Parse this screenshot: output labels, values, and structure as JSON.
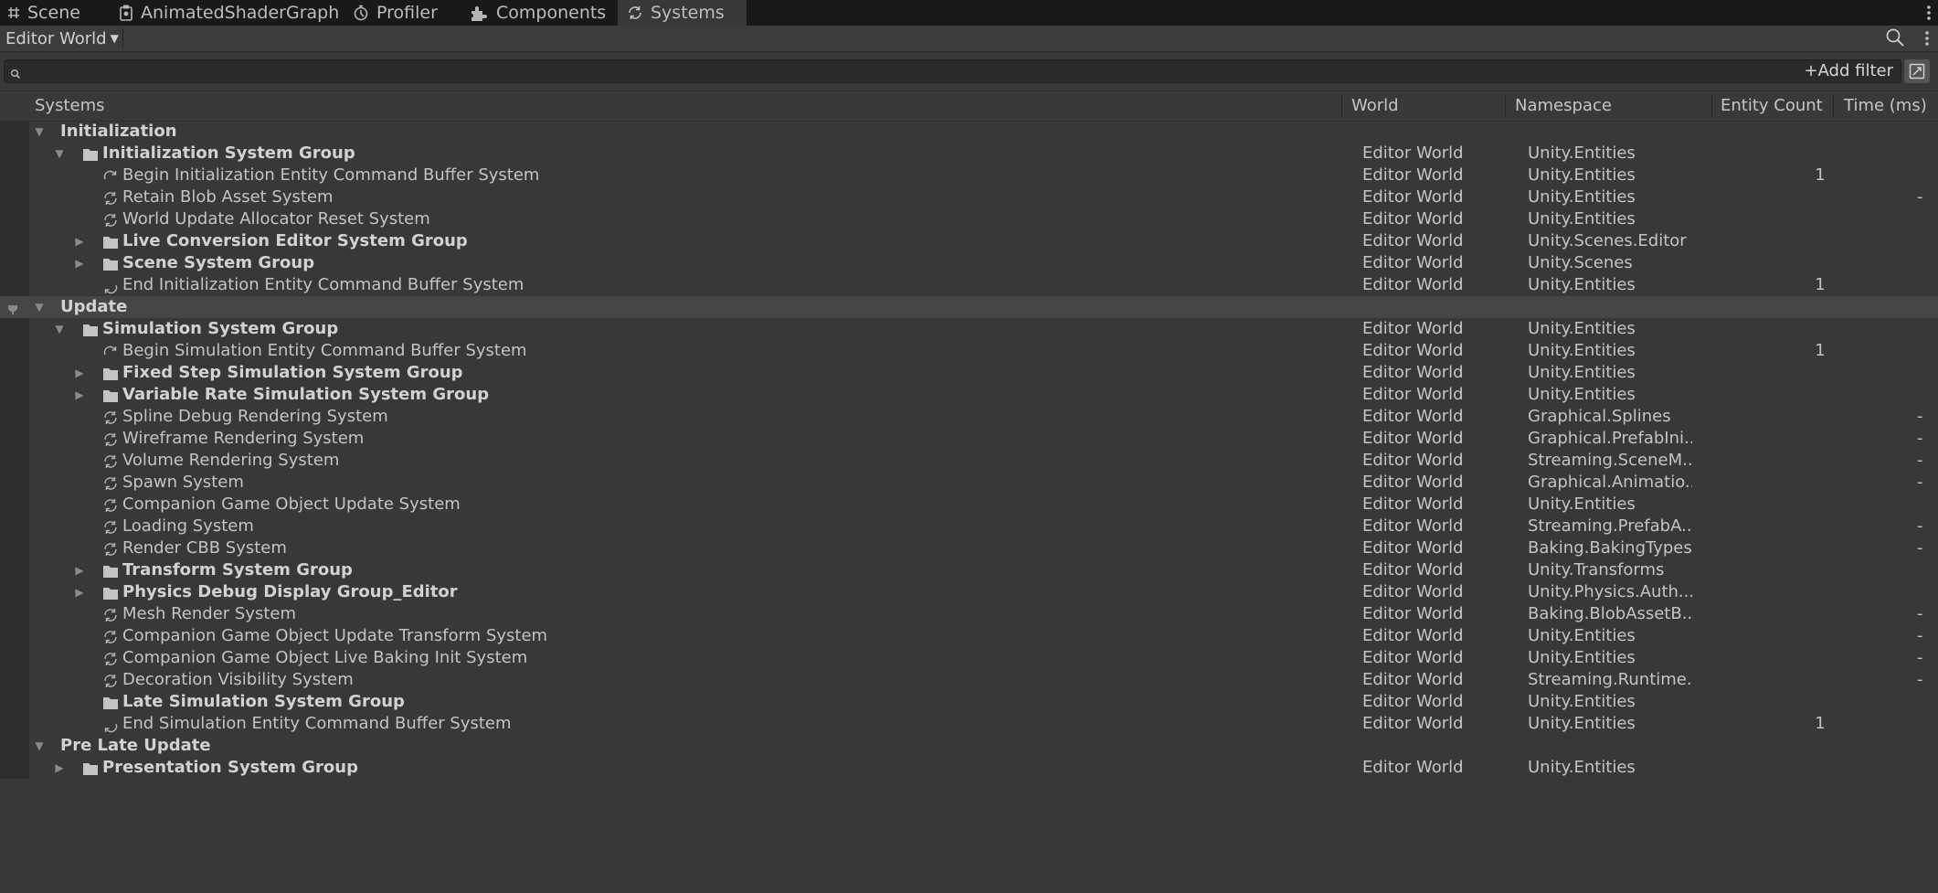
{
  "tabs": [
    {
      "label": "Scene",
      "icon": "grid-icon",
      "active": false
    },
    {
      "label": "AnimatedShaderGraph",
      "icon": "shader-graph-icon",
      "active": false
    },
    {
      "label": "Profiler",
      "icon": "stopwatch-icon",
      "active": false
    },
    {
      "label": "Components",
      "icon": "components-icon",
      "active": false
    },
    {
      "label": "Systems",
      "icon": "systems-icon",
      "active": true
    }
  ],
  "toolbar": {
    "world_selector": "Editor World"
  },
  "search": {
    "value": "",
    "placeholder": "",
    "add_filter_label": "Add filter"
  },
  "columns": {
    "systems": "Systems",
    "world": "World",
    "namespace": "Namespace",
    "entity_count": "Entity Count",
    "time": "Time (ms)"
  },
  "rows": [
    {
      "depth": 0,
      "kind": "phase",
      "expanded": true,
      "name": "Initialization",
      "world": "",
      "namespace": "",
      "count": "",
      "time": ""
    },
    {
      "depth": 1,
      "kind": "group",
      "expanded": true,
      "name": "Initialization System Group",
      "world": "Editor World",
      "namespace": "Unity.Entities",
      "count": "",
      "time": ""
    },
    {
      "depth": 2,
      "kind": "begin-ecb",
      "name": "Begin Initialization Entity Command Buffer System",
      "world": "Editor World",
      "namespace": "Unity.Entities",
      "count": "1",
      "time": ""
    },
    {
      "depth": 2,
      "kind": "system",
      "name": "Retain Blob Asset System",
      "world": "Editor World",
      "namespace": "Unity.Entities",
      "count": "",
      "time": "-"
    },
    {
      "depth": 2,
      "kind": "system",
      "name": "World Update Allocator Reset System",
      "world": "Editor World",
      "namespace": "Unity.Entities",
      "count": "",
      "time": ""
    },
    {
      "depth": 2,
      "kind": "group",
      "expanded": false,
      "name": "Live Conversion Editor System Group",
      "world": "Editor World",
      "namespace": "Unity.Scenes.Editor",
      "count": "",
      "time": ""
    },
    {
      "depth": 2,
      "kind": "group",
      "expanded": false,
      "name": "Scene System Group",
      "world": "Editor World",
      "namespace": "Unity.Scenes",
      "count": "",
      "time": ""
    },
    {
      "depth": 2,
      "kind": "end-ecb",
      "name": "End Initialization Entity Command Buffer System",
      "world": "Editor World",
      "namespace": "Unity.Entities",
      "count": "1",
      "time": ""
    },
    {
      "depth": 0,
      "kind": "phase",
      "expanded": true,
      "selected": true,
      "pinned": true,
      "name": "Update",
      "world": "",
      "namespace": "",
      "count": "",
      "time": ""
    },
    {
      "depth": 1,
      "kind": "group",
      "expanded": true,
      "name": "Simulation System Group",
      "world": "Editor World",
      "namespace": "Unity.Entities",
      "count": "",
      "time": ""
    },
    {
      "depth": 2,
      "kind": "begin-ecb",
      "name": "Begin Simulation Entity Command Buffer System",
      "world": "Editor World",
      "namespace": "Unity.Entities",
      "count": "1",
      "time": ""
    },
    {
      "depth": 2,
      "kind": "group",
      "expanded": false,
      "name": "Fixed Step Simulation System Group",
      "world": "Editor World",
      "namespace": "Unity.Entities",
      "count": "",
      "time": ""
    },
    {
      "depth": 2,
      "kind": "group",
      "expanded": false,
      "name": "Variable Rate Simulation System Group",
      "world": "Editor World",
      "namespace": "Unity.Entities",
      "count": "",
      "time": ""
    },
    {
      "depth": 2,
      "kind": "system",
      "name": "Spline Debug Rendering System",
      "world": "Editor World",
      "namespace": "Graphical.Splines",
      "count": "",
      "time": "-"
    },
    {
      "depth": 2,
      "kind": "system",
      "name": "Wireframe Rendering System",
      "world": "Editor World",
      "namespace": "Graphical.PrefabIni...",
      "count": "",
      "time": "-"
    },
    {
      "depth": 2,
      "kind": "system",
      "name": "Volume Rendering System",
      "world": "Editor World",
      "namespace": "Streaming.SceneM...",
      "count": "",
      "time": "-"
    },
    {
      "depth": 2,
      "kind": "system",
      "name": "Spawn System",
      "world": "Editor World",
      "namespace": "Graphical.Animatio...",
      "count": "",
      "time": "-"
    },
    {
      "depth": 2,
      "kind": "system",
      "name": "Companion Game Object Update System",
      "world": "Editor World",
      "namespace": "Unity.Entities",
      "count": "",
      "time": ""
    },
    {
      "depth": 2,
      "kind": "system",
      "name": "Loading System",
      "world": "Editor World",
      "namespace": "Streaming.PrefabA...",
      "count": "",
      "time": "-"
    },
    {
      "depth": 2,
      "kind": "system",
      "name": "Render CBB System",
      "world": "Editor World",
      "namespace": "Baking.BakingTypes",
      "count": "",
      "time": "-"
    },
    {
      "depth": 2,
      "kind": "group",
      "expanded": false,
      "name": "Transform System Group",
      "world": "Editor World",
      "namespace": "Unity.Transforms",
      "count": "",
      "time": ""
    },
    {
      "depth": 2,
      "kind": "group",
      "expanded": false,
      "name": "Physics Debug Display Group_Editor",
      "world": "Editor World",
      "namespace": "Unity.Physics.Auth...",
      "count": "",
      "time": ""
    },
    {
      "depth": 2,
      "kind": "system",
      "name": "Mesh Render System",
      "world": "Editor World",
      "namespace": "Baking.BlobAssetB...",
      "count": "",
      "time": "-"
    },
    {
      "depth": 2,
      "kind": "system",
      "name": "Companion Game Object Update Transform System",
      "world": "Editor World",
      "namespace": "Unity.Entities",
      "count": "",
      "time": "-"
    },
    {
      "depth": 2,
      "kind": "system",
      "name": "Companion Game Object Live Baking Init System",
      "world": "Editor World",
      "namespace": "Unity.Entities",
      "count": "",
      "time": "-"
    },
    {
      "depth": 2,
      "kind": "system",
      "name": "Decoration Visibility System",
      "world": "Editor World",
      "namespace": "Streaming.Runtime...",
      "count": "",
      "time": "-"
    },
    {
      "depth": 2,
      "kind": "group",
      "leaf": true,
      "name": "Late Simulation System Group",
      "world": "Editor World",
      "namespace": "Unity.Entities",
      "count": "",
      "time": ""
    },
    {
      "depth": 2,
      "kind": "end-ecb",
      "name": "End Simulation Entity Command Buffer System",
      "world": "Editor World",
      "namespace": "Unity.Entities",
      "count": "1",
      "time": ""
    },
    {
      "depth": 0,
      "kind": "phase",
      "expanded": true,
      "name": "Pre Late Update",
      "world": "",
      "namespace": "",
      "count": "",
      "time": ""
    },
    {
      "depth": 1,
      "kind": "group",
      "expanded": false,
      "name": "Presentation System Group",
      "world": "Editor World",
      "namespace": "Unity.Entities",
      "count": "",
      "time": ""
    }
  ]
}
